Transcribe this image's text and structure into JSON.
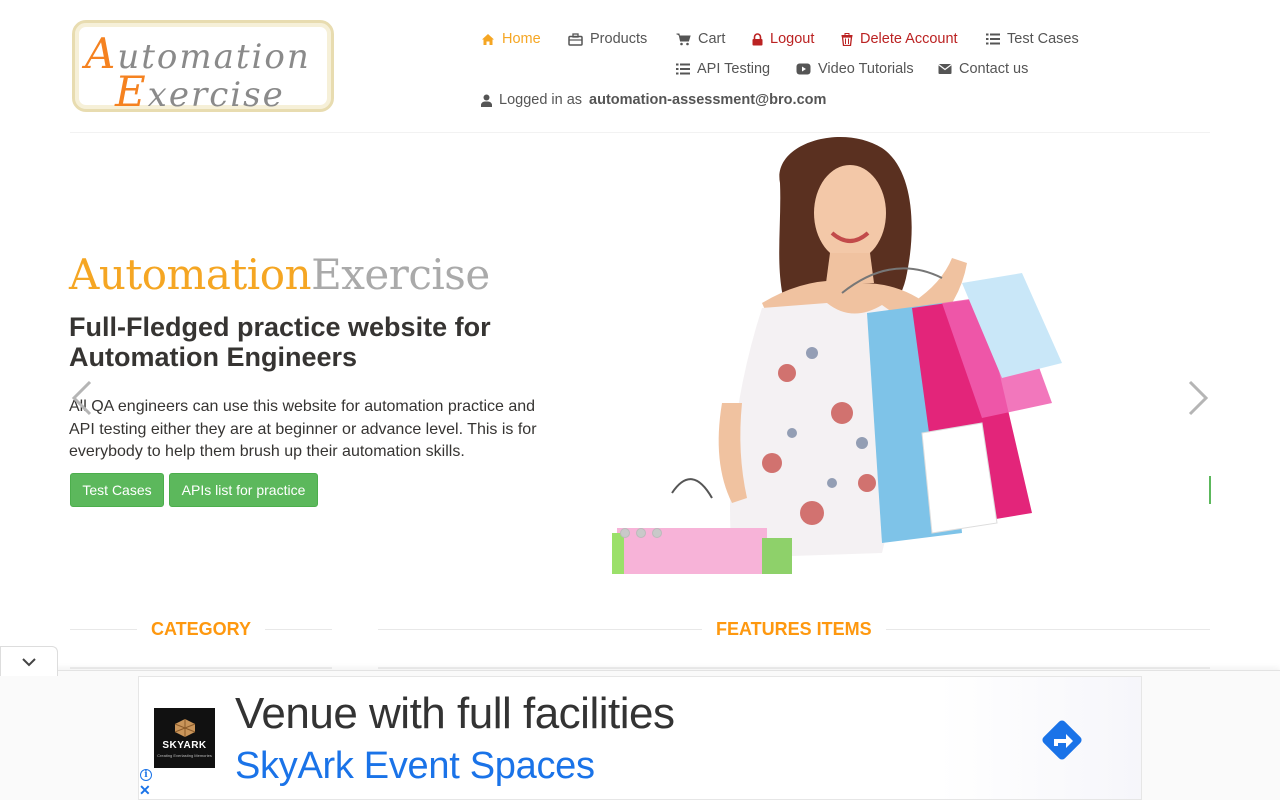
{
  "brand": {
    "logo_word1": "Automation",
    "logo_word2": "Exercise"
  },
  "nav": {
    "items": [
      {
        "label": "Home",
        "icon": "home-icon",
        "active": true
      },
      {
        "label": "Products",
        "icon": "briefcase-icon"
      },
      {
        "label": "Cart",
        "icon": "cart-icon"
      },
      {
        "label": "Logout",
        "icon": "lock-icon"
      },
      {
        "label": "Delete Account",
        "icon": "trash-icon"
      },
      {
        "label": "Test Cases",
        "icon": "list-icon"
      },
      {
        "label": "API Testing",
        "icon": "list-icon"
      },
      {
        "label": "Video Tutorials",
        "icon": "youtube-play-icon"
      },
      {
        "label": "Contact us",
        "icon": "envelope-icon"
      }
    ],
    "logged_in_prefix": "Logged in as",
    "logged_in_user": "automation-assessment@bro.com"
  },
  "hero": {
    "brand_part1": "Automation",
    "brand_part2": "Exercise",
    "title": "Full-Fledged practice website for Automation Engineers",
    "text": "All QA engineers can use this website for automation practice and API testing either they are at beginner or advance level. This is for everybody to help them brush up their automation skills.",
    "button_test_cases": "Test Cases",
    "button_apis": "APIs list for practice",
    "image_alt": "woman-with-shopping-bags",
    "slide_count": 3
  },
  "sections": {
    "category": "CATEGORY",
    "features": "FEATURES ITEMS"
  },
  "ad": {
    "logo_name": "SKYARK",
    "logo_tagline": "Creating Everlasting Memories",
    "headline": "Venue with full facilities",
    "subline": "SkyArk Event Spaces",
    "info_glyph": "i",
    "close_glyph": "✕"
  },
  "colors": {
    "accent_orange": "#fe980f",
    "active_nav": "#f5a623",
    "danger_red": "#b22222",
    "button_green": "#5cb85c",
    "ad_blue": "#1a73e8"
  }
}
